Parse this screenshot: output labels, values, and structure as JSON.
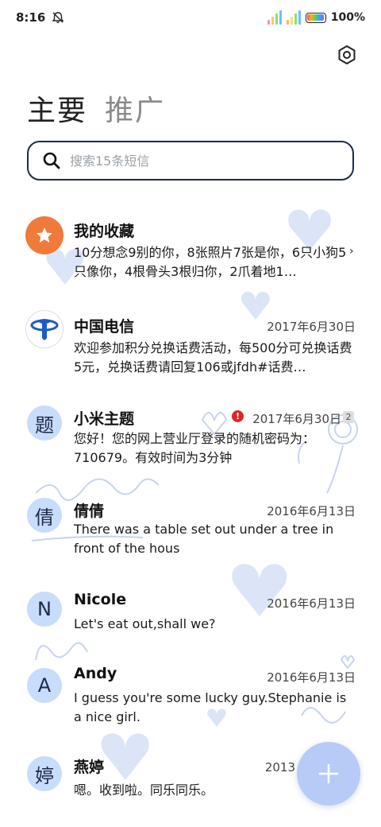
{
  "status": {
    "time": "8:16",
    "battery_pct": "100%",
    "battery_level": 1.0
  },
  "tabs": [
    {
      "label": "主要"
    },
    {
      "label": "推广"
    }
  ],
  "search": {
    "placeholder": "搜索15条短信"
  },
  "conversations": [
    {
      "name": "我的收藏",
      "avatar_icon": "star-icon",
      "preview": "10分想念9别的你，8张照片7张是你，6只小狗5只像你，4根骨头3根归你，2爪着地1…",
      "date": ""
    },
    {
      "name": "中国电信",
      "avatar_icon": "china-telecom-logo",
      "preview": "欢迎参加积分兑换话费活动，每500分可兑换话费5元，兑换话费请回复106或jfdh#话费…",
      "date": "2017年6月30日"
    },
    {
      "name": "小米主题",
      "avatar_letter": "题",
      "preview": "您好！您的网上营业厅登录的随机密码为：710679。有效时间为3分钟",
      "date": "2017年6月30日",
      "alert": "!",
      "count": "2"
    },
    {
      "name": "倩倩",
      "avatar_letter": "倩",
      "preview": "There was a table set out under a tree in front of the hous",
      "date": "2016年6月13日"
    },
    {
      "name": "Nicole",
      "avatar_letter": "N",
      "preview": "Let's eat out,shall we?",
      "date": "2016年6月13日"
    },
    {
      "name": "Andy",
      "avatar_letter": "A",
      "preview": "I guess you're some lucky guy.Stephanie is a nice girl.",
      "date": "2016年6月13日"
    },
    {
      "name": "燕婷",
      "avatar_letter": "婷",
      "preview": "嗯。收到啦。同乐同乐。",
      "date": "2013"
    }
  ],
  "fab": {
    "icon": "plus-icon"
  },
  "colors": {
    "accent": "#1d2a4a",
    "avatar_bg": "#c8dcfb",
    "favorites_orange": "#f07a3a",
    "alert_red": "#e02424",
    "fab_blue": "#b6ccf6"
  }
}
